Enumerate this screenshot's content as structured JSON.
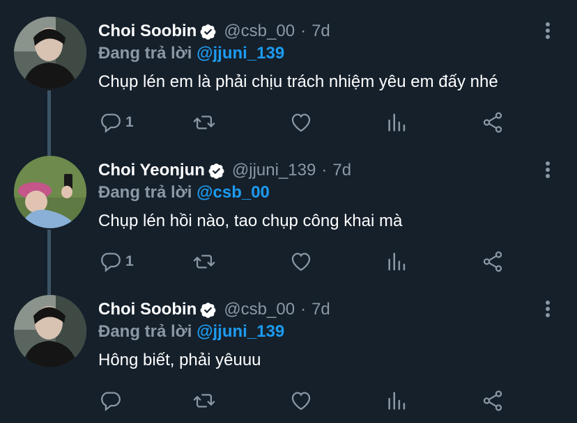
{
  "colors": {
    "background": "#15202b",
    "secondary_text": "#8b98a5",
    "link": "#1d9bf0",
    "verified": "#ffffff",
    "thread_line": "#3d5466"
  },
  "tweets": [
    {
      "name": "Choi Soobin",
      "handle": "@csb_00",
      "separator": "·",
      "time": "7d",
      "reply_prefix": "Đang trả lời",
      "reply_to": "@jjuni_139",
      "text": "Chụp lén em là phải chịu trách nhiệm yêu em đấy nhé",
      "reply_count": "1",
      "icons": [
        "reply-icon",
        "retweet-icon",
        "like-icon",
        "analytics-icon",
        "share-icon",
        "more-icon"
      ]
    },
    {
      "name": "Choi Yeonjun",
      "handle": "@jjuni_139",
      "separator": "·",
      "time": "7d",
      "reply_prefix": "Đang trả lời",
      "reply_to": "@csb_00",
      "text": "Chụp lén hồi nào, tao chụp công khai mà",
      "reply_count": "1",
      "icons": [
        "reply-icon",
        "retweet-icon",
        "like-icon",
        "analytics-icon",
        "share-icon",
        "more-icon"
      ]
    },
    {
      "name": "Choi Soobin",
      "handle": "@csb_00",
      "separator": "·",
      "time": "7d",
      "reply_prefix": "Đang trả lời",
      "reply_to": "@jjuni_139",
      "text": "Hông biết, phải yêuuu",
      "reply_count": "",
      "icons": [
        "reply-icon",
        "retweet-icon",
        "like-icon",
        "analytics-icon",
        "share-icon",
        "more-icon"
      ]
    }
  ]
}
